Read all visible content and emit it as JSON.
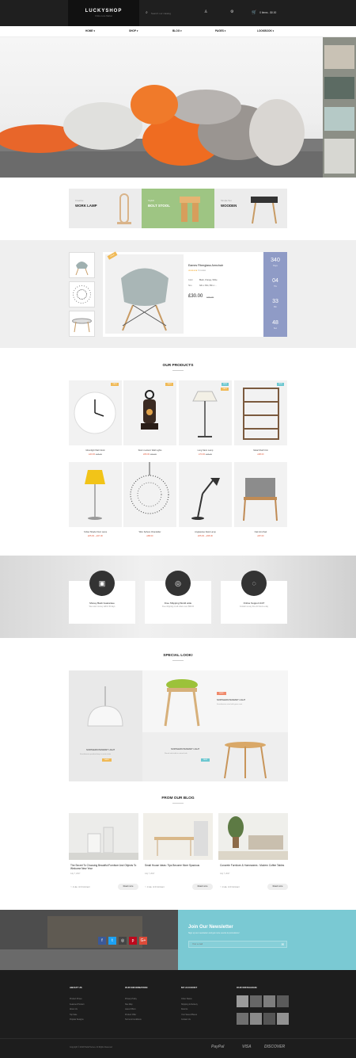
{
  "header": {
    "logo": "LUCKYSHOP",
    "tagline": "Online Luxe Market",
    "search_placeholder": "Search our catalog",
    "cart": "0 items - $0.00"
  },
  "nav": [
    "HOME",
    "SHOP",
    "BLOG",
    "PAGES",
    "LOOKBOOK"
  ],
  "promos": [
    {
      "tag": "Creative",
      "title": "WORK LAMP"
    },
    {
      "tag": "Stylish",
      "title": "BOLT STOOL"
    },
    {
      "tag": "Simple Set",
      "title": "WOODEN"
    }
  ],
  "deal": {
    "name": "Eames Fiberglass Armchair",
    "reviews": "0 review",
    "color_label": "Color",
    "color_value": "Black, Orange, White",
    "size_label": "Size",
    "size_value": "32in x 36in, 50in x ...",
    "price": "£30.00",
    "old_price": "£35.00",
    "badge": "SALE",
    "countdown": [
      {
        "n": "340",
        "l": "Days"
      },
      {
        "n": "04",
        "l": "Hrs"
      },
      {
        "n": "33",
        "l": "Min"
      },
      {
        "n": "48",
        "l": "Sec"
      }
    ]
  },
  "products": {
    "title": "OUR PRODUCTS",
    "items": [
      {
        "name": "Moonlight Wall Clock",
        "price": "£40.00",
        "old": "£48.00",
        "badge": "SALE",
        "bc": "#f0b955"
      },
      {
        "name": "Storm Lantern Wall Lights",
        "price": "£56.00",
        "old": "£60.00",
        "badge": "SALE",
        "bc": "#f0b955"
      },
      {
        "name": "Long Stem Lamp",
        "price": "£70.00",
        "old": "£75.00",
        "badge": "NEW",
        "bc": "#6cc7d0",
        "badge2": "SALE"
      },
      {
        "name": "Metal Shelf Unit",
        "price": "£98.00",
        "old": "",
        "badge": "NEW",
        "bc": "#6cc7d0"
      },
      {
        "name": "Yellow Shade Floor Lamp",
        "price": "£65.00 – £97.00",
        "old": "",
        "badge": "",
        "bc": ""
      },
      {
        "name": "Wire Sphere Chandelier",
        "price": "£88.00",
        "old": "",
        "badge": "",
        "bc": ""
      },
      {
        "name": "Anglepoise Desk Lamp",
        "price": "£55.00 – £58.00",
        "old": "",
        "badge": "",
        "bc": ""
      },
      {
        "name": "Oak Armchair",
        "price": "£87.00",
        "old": "",
        "badge": "",
        "bc": ""
      }
    ]
  },
  "services": [
    {
      "title": "Money Back Guarantee",
      "desc": "We return money within 30 days",
      "icon": "▣"
    },
    {
      "title": "Free Shipping World wide",
      "desc": "Free shipping on all orders over $90.00",
      "icon": "◎"
    },
    {
      "title": "Online Support 24/7",
      "desc": "Contact us any time 24 hours a day",
      "icon": "◌"
    }
  ],
  "special": {
    "title": "SPECIAL LOOK!",
    "cards": [
      {
        "title": "NORTHERN PENDANT LIGHT",
        "desc": "Scandinavian pendant lamp in matte white",
        "tag": "SALE"
      },
      {
        "title": "NORTHERN PENDANT LIGHT",
        "desc": "Scandinavian stool with green seat",
        "tag": "SALE"
      },
      {
        "title": "NORTHERN PENDANT LIGHT",
        "desc": "Round side table in natural oak",
        "tag": "NEW"
      }
    ]
  },
  "blog": {
    "title": "FROM OUR BLOG",
    "posts": [
      {
        "title": "The Secret To Choosing Beautiful Furniture And Objects To Welcome New Year",
        "date": "July 7, 2017",
        "likes": "1 Like",
        "comments": "0 Comment",
        "more": "Read more"
      },
      {
        "title": "Small House Ideas: Tips Become More Spacious",
        "date": "July 7, 2017",
        "likes": "1 Like",
        "comments": "0 Comment",
        "more": "Read more"
      },
      {
        "title": "Concrete Furniture & Homewares : Modern Coffee Tables",
        "date": "July 7, 2017",
        "likes": "1 Like",
        "comments": "0 Comment",
        "more": "Read more"
      }
    ]
  },
  "newsletter": {
    "title": "Join Our Newsletter",
    "desc": "Sign up our newsletter and get more events & promotions!",
    "placeholder": "Your e-mail"
  },
  "footer": {
    "cols": [
      {
        "title": "ABOUT US",
        "links": [
          "Product Prices",
          "Featured Product",
          "About Us",
          "Top Sale",
          "Popular Designs"
        ]
      },
      {
        "title": "OUR INFORMATION",
        "links": [
          "Privacy Policy",
          "Site Map",
          "Latest Offers",
          "Product Offer",
          "Terms & Conditions"
        ]
      },
      {
        "title": "MY ACCOUNT",
        "links": [
          "Order Status",
          "Shipping & Delivery",
          "Returns",
          "Your Saved Places",
          "Contact Us"
        ]
      },
      {
        "title": "OUR INSTAGRAM",
        "links": []
      }
    ],
    "copyright": "Copyright © 2016 PlazaThemes. All Rights Reserved",
    "payments": [
      "PayPal",
      "VISA",
      "DISCOVER"
    ]
  }
}
